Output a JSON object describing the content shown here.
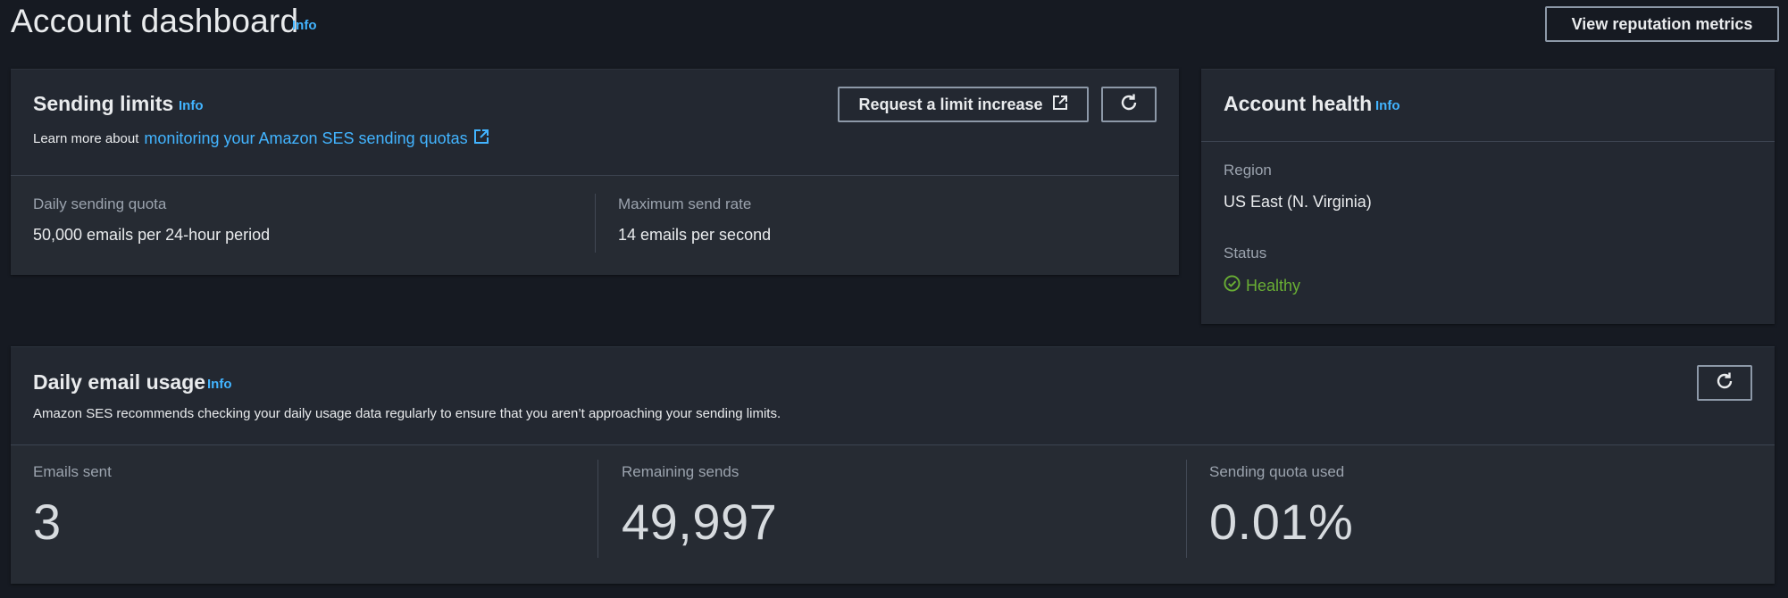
{
  "header": {
    "title": "Account dashboard",
    "info": "Info",
    "reputation_button": "View reputation metrics"
  },
  "sending_limits": {
    "title": "Sending limits",
    "info": "Info",
    "learn_prefix": "Learn more about",
    "learn_link": "monitoring your Amazon SES sending quotas",
    "request_button": "Request a limit increase",
    "refresh_icon": "refresh-icon",
    "daily_quota_label": "Daily sending quota",
    "daily_quota_value": "50,000 emails per 24-hour period",
    "max_rate_label": "Maximum send rate",
    "max_rate_value": "14 emails per second"
  },
  "account_health": {
    "title": "Account health",
    "info": "Info",
    "region_label": "Region",
    "region_value": "US East (N. Virginia)",
    "status_label": "Status",
    "status_value": "Healthy",
    "status_color": "#69ae34",
    "status_icon": "check-circle-icon"
  },
  "daily_usage": {
    "title": "Daily email usage",
    "info": "Info",
    "description": "Amazon SES recommends checking your daily usage data regularly to ensure that you aren’t approaching your sending limits.",
    "refresh_icon": "refresh-icon",
    "emails_sent_label": "Emails sent",
    "emails_sent_value": "3",
    "remaining_label": "Remaining sends",
    "remaining_value": "49,997",
    "quota_used_label": "Sending quota used",
    "quota_used_value": "0.01%"
  },
  "colors": {
    "background": "#161a22",
    "panel": "#232831",
    "link": "#42b4ff",
    "healthy": "#69ae34"
  }
}
